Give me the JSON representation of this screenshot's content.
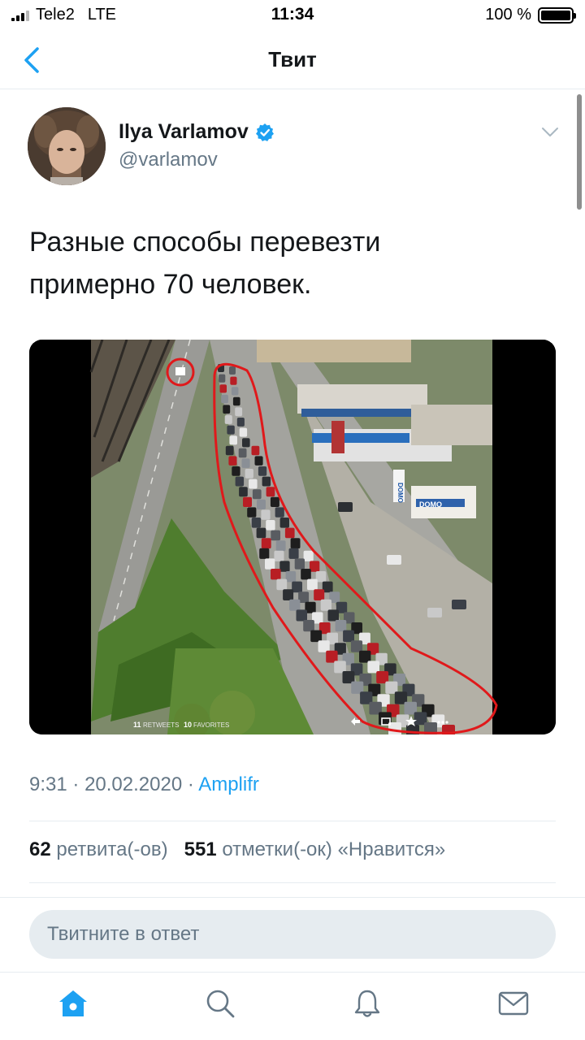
{
  "status_bar": {
    "carrier": "Tele2",
    "network": "LTE",
    "time": "11:34",
    "battery": "100 %"
  },
  "nav": {
    "title": "Твит",
    "back_icon": "chevron-left-icon"
  },
  "tweet": {
    "author_name": "Ilya Varlamov",
    "author_handle": "@varlamov",
    "verified": true,
    "text_line1": "Разные способы перевезти",
    "text_line2": "примерно 70 человек.",
    "media_caption": {
      "retweets_count": "11",
      "retweets_label": "RETWEETS",
      "favorites_count": "10",
      "favorites_label": "FAVORITES",
      "sign_1": "DOMO",
      "sign_2": "DOMO"
    },
    "time": "9:31",
    "date": "20.02.2020",
    "separator": "·",
    "source": "Amplifr",
    "retweets": "62",
    "retweets_label": "ретвита(-ов)",
    "likes": "551",
    "likes_label": "отметки(-ок) «Нравится»"
  },
  "reply": {
    "placeholder": "Твитните в ответ"
  },
  "tab_bar": {
    "items": [
      "home-icon",
      "search-icon",
      "notifications-icon",
      "messages-icon"
    ],
    "active_color": "#1da1f2",
    "inactive_color": "#657786"
  },
  "colors": {
    "accent": "#1da1f2",
    "text": "#14171a",
    "secondary": "#657786",
    "highlight": "#e0191b"
  }
}
